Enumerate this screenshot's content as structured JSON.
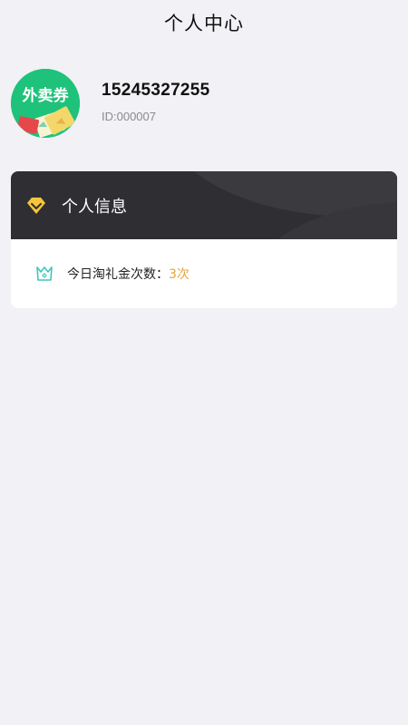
{
  "header": {
    "title": "个人中心"
  },
  "profile": {
    "avatar_text": "外卖券",
    "phone": "15245327255",
    "id_text": "ID:000007"
  },
  "card": {
    "title": "个人信息",
    "stat_label": "今日淘礼金次数：",
    "stat_value": "3次"
  },
  "icons": {
    "card_title_icon": "diamond-icon",
    "stat_icon": "crown-icon"
  },
  "colors": {
    "background": "#f1f1f6",
    "card_header": "#2f2f33",
    "accent_value": "#e8a33d",
    "avatar_green": "#1fc27a",
    "diamond_gold": "#f5c63c",
    "crown_teal": "#3cc7b7"
  }
}
